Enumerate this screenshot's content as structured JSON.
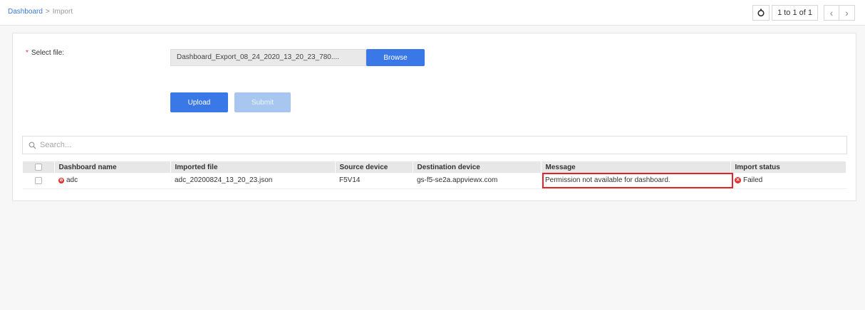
{
  "breadcrumb": {
    "parent": "Dashboard",
    "separator": ">",
    "current": "Import"
  },
  "pager": {
    "refresh_icon": "refresh-icon",
    "range_text": "1 to 1 of 1",
    "prev_glyph": "‹",
    "next_glyph": "›"
  },
  "form": {
    "required_mark": "*",
    "select_label": "Select file:",
    "file_value": "Dashboard_Export_08_24_2020_13_20_23_780....",
    "browse_label": "Browse",
    "upload_label": "Upload",
    "submit_label": "Submit"
  },
  "search": {
    "placeholder": "Search..."
  },
  "table": {
    "headers": [
      "Dashboard name",
      "Imported file",
      "Source device",
      "Destination device",
      "Message",
      "Import status"
    ],
    "rows": [
      {
        "dashboard_name": "adc",
        "imported_file": "adc_20200824_13_20_23.json",
        "source_device": "F5V14",
        "destination_device": "gs-f5-se2a.appviewx.com",
        "message": "Permission not available for dashboard.",
        "import_status": "Failed"
      }
    ]
  },
  "colors": {
    "accent": "#3b78e7",
    "error": "#e03131",
    "highlight": "#e8222a"
  }
}
